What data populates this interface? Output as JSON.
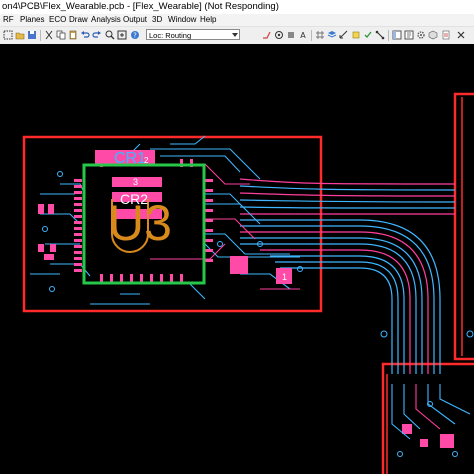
{
  "window": {
    "title": "on4\\PCB\\Flex_Wearable.pcb - [Flex_Wearable] (Not Responding)"
  },
  "menu": {
    "items": [
      "RF",
      "Planes",
      "ECO",
      "Draw",
      "Analysis",
      "Output",
      "3D",
      "Window",
      "Help"
    ]
  },
  "toolbar": {
    "loc_label": "Loc: Routing"
  },
  "board": {
    "components": {
      "cr1": "CR1",
      "cr2": "CR2",
      "u3": "U3",
      "c3": "3",
      "n2": "2",
      "n1": "1"
    }
  },
  "colors": {
    "outline": "#ff2a2a",
    "trace_blue": "#3fb6ff",
    "trace_pink": "#ff3f9e",
    "courtyard": "#27c84a",
    "silk_orange": "#d98a1c",
    "copper_pink": "#ff4aa8"
  }
}
